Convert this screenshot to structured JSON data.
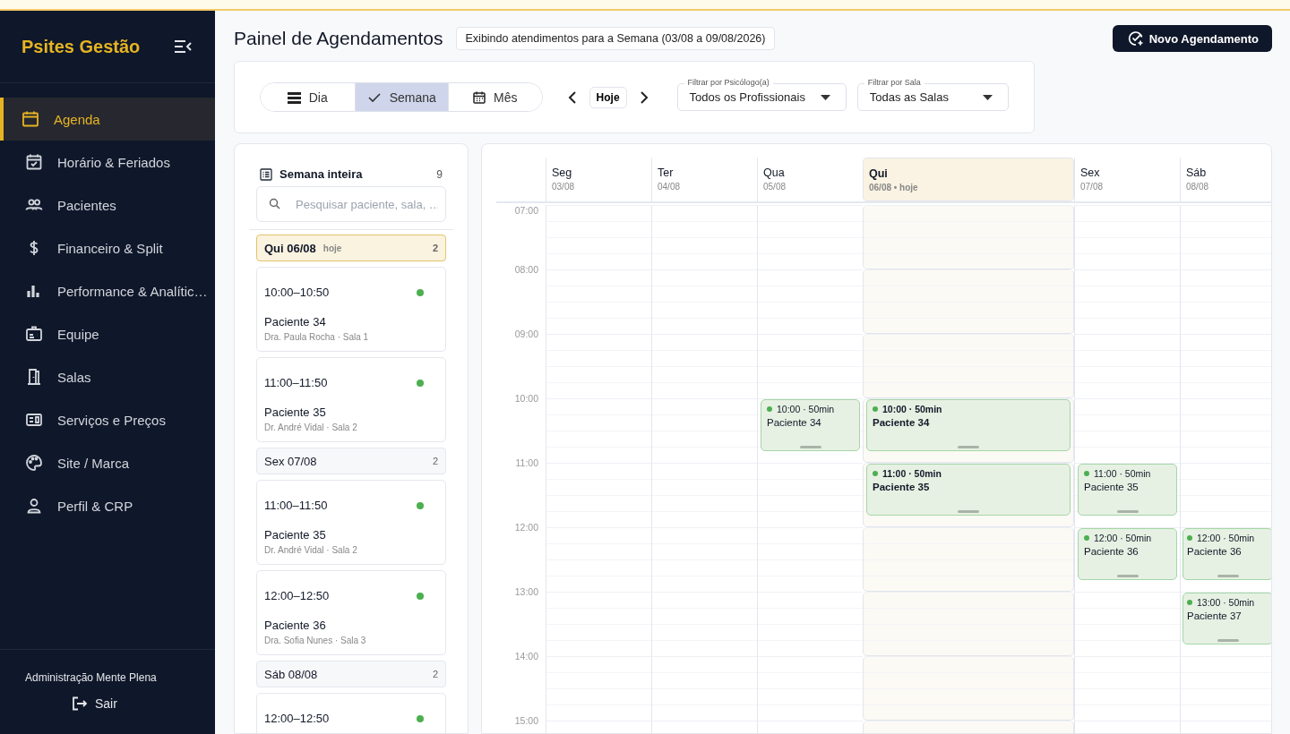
{
  "sidebar": {
    "brand": "Psites Gestão",
    "items": [
      {
        "label": "Agenda",
        "selected": true
      },
      {
        "label": "Horário & Feriados",
        "selected": false
      },
      {
        "label": "Pacientes",
        "selected": false
      },
      {
        "label": "Financeiro & Split",
        "selected": false
      },
      {
        "label": "Performance & Analític…",
        "selected": false
      },
      {
        "label": "Equipe",
        "selected": false
      },
      {
        "label": "Salas",
        "selected": false
      },
      {
        "label": "Serviços e Preços",
        "selected": false
      },
      {
        "label": "Site / Marca",
        "selected": false
      },
      {
        "label": "Perfil & CRP",
        "selected": false
      }
    ],
    "account": "Administração Mente Plena",
    "logout": "Sair"
  },
  "header": {
    "title": "Painel de Agendamentos",
    "range": "Exibindo atendimentos para a Semana (03/08 a 09/08/2026)",
    "new_button": "Novo Agendamento"
  },
  "toolbar": {
    "views": [
      {
        "label": "Dia",
        "selected": false
      },
      {
        "label": "Semana",
        "selected": true
      },
      {
        "label": "Mês",
        "selected": false
      }
    ],
    "today": "Hoje",
    "filters": [
      {
        "label": "Filtrar por Psicólogo(a)",
        "value": "Todos os Profissionais"
      },
      {
        "label": "Filtrar por Sala",
        "value": "Todas as Salas"
      }
    ]
  },
  "list": {
    "title": "Semana inteira",
    "count": "9",
    "search": {
      "placeholder": "Pesquisar paciente, sala, …"
    },
    "groups": [
      {
        "label": "Qui 06/08",
        "tag": "hoje",
        "count": "2",
        "today": true,
        "appointments": [
          {
            "time": "10:00–10:50",
            "patient": "Paciente 34",
            "detail": "Dra. Paula Rocha · Sala 1",
            "color": "#4caf50"
          },
          {
            "time": "11:00–11:50",
            "patient": "Paciente 35",
            "detail": "Dr. André Vidal · Sala 2",
            "color": "#4caf50"
          }
        ]
      },
      {
        "label": "Sex 07/08",
        "count": "2",
        "today": false,
        "appointments": [
          {
            "time": "11:00–11:50",
            "patient": "Paciente 35",
            "detail": "Dr. André Vidal · Sala 2",
            "color": "#4caf50"
          },
          {
            "time": "12:00–12:50",
            "patient": "Paciente 36",
            "detail": "Dra. Sofia Nunes · Sala 3",
            "color": "#4caf50"
          }
        ]
      },
      {
        "label": "Sáb 08/08",
        "count": "2",
        "today": false,
        "appointments": [
          {
            "time": "12:00–12:50",
            "color": "#4caf50"
          }
        ]
      }
    ]
  },
  "calendar": {
    "days": [
      {
        "name": "Seg",
        "date": "03/08",
        "today": false
      },
      {
        "name": "Ter",
        "date": "04/08",
        "today": false
      },
      {
        "name": "Qua",
        "date": "05/08",
        "today": false
      },
      {
        "name": "Qui",
        "date": "06/08 • hoje",
        "today": true
      },
      {
        "name": "Sex",
        "date": "07/08",
        "today": false
      },
      {
        "name": "Sáb",
        "date": "08/08",
        "today": false
      }
    ],
    "rows": [
      {
        "time": "07:00",
        "cells": [
          {
            "kind": "empty"
          },
          {
            "kind": "empty"
          },
          {
            "kind": "empty"
          },
          {
            "kind": "empty"
          },
          {
            "kind": "empty"
          },
          {
            "kind": "empty"
          }
        ]
      },
      {
        "time": "08:00",
        "cells": [
          {
            "kind": "empty"
          },
          {
            "kind": "empty"
          },
          {
            "kind": "empty"
          },
          {
            "kind": "empty"
          },
          {
            "kind": "empty"
          },
          {
            "kind": "empty"
          }
        ]
      },
      {
        "time": "09:00",
        "cells": [
          {
            "kind": "empty"
          },
          {
            "kind": "empty"
          },
          {
            "kind": "empty"
          },
          {
            "kind": "empty"
          },
          {
            "kind": "empty"
          },
          {
            "kind": "empty"
          }
        ]
      },
      {
        "time": "10:00",
        "cells": [
          {
            "kind": "empty"
          },
          {
            "kind": "empty"
          },
          {
            "kind": "event",
            "time": "10:00 · 50min",
            "patient": "Paciente 34",
            "color": "#4caf50"
          },
          {
            "kind": "event",
            "time": "10:00 · 50min",
            "patient": "Paciente 34",
            "color": "#4caf50"
          },
          {
            "kind": "empty"
          },
          {
            "kind": "empty"
          }
        ]
      },
      {
        "time": "11:00",
        "cells": [
          {
            "kind": "empty"
          },
          {
            "kind": "empty"
          },
          {
            "kind": "empty"
          },
          {
            "kind": "event",
            "time": "11:00 · 50min",
            "patient": "Paciente 35",
            "color": "#4caf50"
          },
          {
            "kind": "event",
            "time": "11:00 · 50min",
            "patient": "Paciente 35",
            "color": "#4caf50"
          },
          {
            "kind": "empty"
          }
        ]
      },
      {
        "time": "12:00",
        "cells": [
          {
            "kind": "empty"
          },
          {
            "kind": "empty"
          },
          {
            "kind": "empty"
          },
          {
            "kind": "empty"
          },
          {
            "kind": "event",
            "time": "12:00 · 50min",
            "patient": "Paciente 36",
            "color": "#4caf50"
          },
          {
            "kind": "event",
            "time": "12:00 · 50min",
            "patient": "Paciente 36",
            "color": "#4caf50"
          }
        ]
      },
      {
        "time": "13:00",
        "cells": [
          {
            "kind": "empty"
          },
          {
            "kind": "empty"
          },
          {
            "kind": "empty"
          },
          {
            "kind": "empty"
          },
          {
            "kind": "empty"
          },
          {
            "kind": "event",
            "time": "13:00 · 50min",
            "patient": "Paciente 37",
            "color": "#4caf50"
          }
        ]
      },
      {
        "time": "14:00",
        "cells": [
          {
            "kind": "empty"
          },
          {
            "kind": "empty"
          },
          {
            "kind": "empty"
          },
          {
            "kind": "empty"
          },
          {
            "kind": "empty"
          },
          {
            "kind": "empty"
          }
        ]
      },
      {
        "time": "15:00",
        "cells": [
          {
            "kind": "empty"
          },
          {
            "kind": "empty"
          },
          {
            "kind": "empty"
          },
          {
            "kind": "empty"
          },
          {
            "kind": "empty"
          },
          {
            "kind": "empty"
          }
        ]
      }
    ]
  }
}
